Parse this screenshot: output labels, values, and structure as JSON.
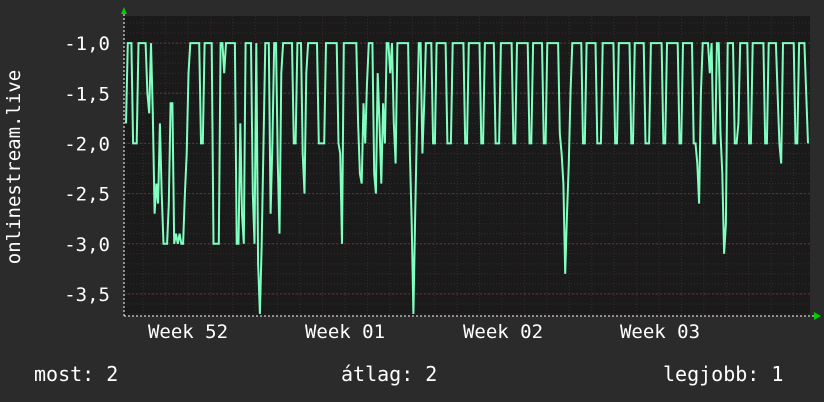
{
  "chart_data": {
    "type": "line",
    "ylabel": "onlinestream.live",
    "ylim": [
      -3.72,
      -0.73
    ],
    "yticks": [
      "-1,0",
      "-1,5",
      "-2,0",
      "-2,5",
      "-3,0",
      "-3,5"
    ],
    "ytick_values": [
      -1.0,
      -1.5,
      -2.0,
      -2.5,
      -3.0,
      -3.5
    ],
    "xticks": [
      "Week 52",
      "Week 01",
      "Week 02",
      "Week 03"
    ],
    "grid": true,
    "colors": {
      "line": "#80ffc0",
      "background": "#2b2b2b",
      "plot": "#1a1a1a",
      "grid": "#5a3030",
      "arrow": "#00cc00"
    },
    "series": [
      {
        "values": [
          -1.8,
          -1,
          -1,
          -1,
          -2,
          -2,
          -2,
          -1,
          -1,
          -1,
          -1,
          -1,
          -1.5,
          -1.7,
          -1,
          -1.7,
          -2.7,
          -2.4,
          -2.6,
          -1.8,
          -2.5,
          -3,
          -3,
          -3,
          -2.6,
          -1.6,
          -1.6,
          -3,
          -2.9,
          -3,
          -2.9,
          -3,
          -3,
          -2.5,
          -2.1,
          -1.3,
          -1,
          -1,
          -1,
          -1,
          -1,
          -1,
          -2,
          -2,
          -1,
          -1,
          -1,
          -1,
          -1,
          -3,
          -3,
          -3,
          -3,
          -1,
          -1,
          -1.3,
          -1,
          -1,
          -1,
          -1,
          -1,
          -1,
          -3,
          -3,
          -1.8,
          -2.7,
          -3,
          -1,
          -1,
          -1,
          -1,
          -2.5,
          -3,
          -1,
          -3.2,
          -3.7,
          -3,
          -2,
          -1,
          -1,
          -1,
          -2.7,
          -2,
          -1,
          -1,
          -2.2,
          -2.9,
          -1.3,
          -1,
          -1,
          -1,
          -1,
          -1,
          -1,
          -2,
          -2,
          -1,
          -1,
          -1,
          -2.1,
          -2.5,
          -1.3,
          -1,
          -1,
          -1,
          -1,
          -1,
          -1,
          -2,
          -2,
          -2,
          -2,
          -1,
          -1,
          -1,
          -1,
          -1,
          -1,
          -1,
          -2,
          -2.1,
          -3,
          -1,
          -1,
          -1,
          -1,
          -1,
          -1,
          -1,
          -1,
          -1.8,
          -2.3,
          -2.4,
          -1.6,
          -2,
          -1.4,
          -1,
          -1,
          -1,
          -2.3,
          -2.5,
          -1.3,
          -1.8,
          -2.4,
          -1.6,
          -2,
          -1,
          -1,
          -1.3,
          -1,
          -1.8,
          -2.2,
          -1,
          -1,
          -1,
          -1,
          -1,
          -1,
          -1,
          -2.1,
          -2.8,
          -3.7,
          -2.7,
          -1.8,
          -1,
          -1,
          -2.1,
          -1.6,
          -1,
          -1,
          -1,
          -1,
          -2,
          -2,
          -1,
          -1,
          -1,
          -1,
          -1,
          -1,
          -2,
          -2,
          -2,
          -1,
          -1,
          -1,
          -1,
          -1,
          -1,
          -1,
          -2,
          -2,
          -1,
          -1,
          -1,
          -1,
          -1,
          -1,
          -1,
          -2,
          -2,
          -1,
          -1,
          -1,
          -1,
          -1,
          -1,
          -2,
          -2,
          -2,
          -1,
          -1,
          -1,
          -1,
          -1,
          -1,
          -1,
          -2,
          -2,
          -1,
          -1,
          -1,
          -1,
          -1,
          -1,
          -1,
          -2,
          -2,
          -1,
          -1,
          -1,
          -1,
          -1,
          -1,
          -2,
          -2,
          -1,
          -1,
          -1,
          -1,
          -1,
          -1,
          -1,
          -1.9,
          -2.1,
          -2.4,
          -3.3,
          -2.7,
          -2.2,
          -1.5,
          -1,
          -1,
          -1,
          -1,
          -1,
          -1,
          -2,
          -2,
          -1,
          -1,
          -1,
          -1,
          -1,
          -1,
          -2,
          -2,
          -2,
          -1,
          -1,
          -1,
          -1,
          -1,
          -1,
          -1,
          -2,
          -2,
          -1,
          -1,
          -1,
          -1,
          -1,
          -1,
          -1,
          -2,
          -2,
          -1,
          -1,
          -1,
          -1,
          -1,
          -1,
          -2,
          -2,
          -2,
          -1,
          -1,
          -1,
          -1,
          -1,
          -1,
          -1,
          -2,
          -2,
          -1,
          -1,
          -1,
          -1,
          -1,
          -1,
          -1,
          -2,
          -2,
          -1,
          -1,
          -1,
          -1,
          -1,
          -1,
          -2,
          -2,
          -2.2,
          -2.6,
          -1.5,
          -1,
          -1,
          -1,
          -1,
          -1.3,
          -1,
          -2,
          -2,
          -1,
          -1,
          -1.9,
          -2.3,
          -3.1,
          -2.8,
          -1,
          -1,
          -1,
          -1,
          -2,
          -2,
          -1.8,
          -1,
          -1,
          -1,
          -1,
          -1,
          -2,
          -2,
          -1,
          -1,
          -1,
          -1,
          -1,
          -1,
          -1,
          -2,
          -2,
          -1,
          -1,
          -1,
          -1,
          -1,
          -1.5,
          -2,
          -2.2,
          -1,
          -1,
          -1,
          -1,
          -1,
          -1,
          -1,
          -2,
          -2,
          -1,
          -1,
          -1,
          -1,
          -1.5,
          -2
        ]
      }
    ]
  },
  "footer": {
    "now": "most: 2",
    "avg": "átlag: 2",
    "best": "legjobb: 1"
  }
}
